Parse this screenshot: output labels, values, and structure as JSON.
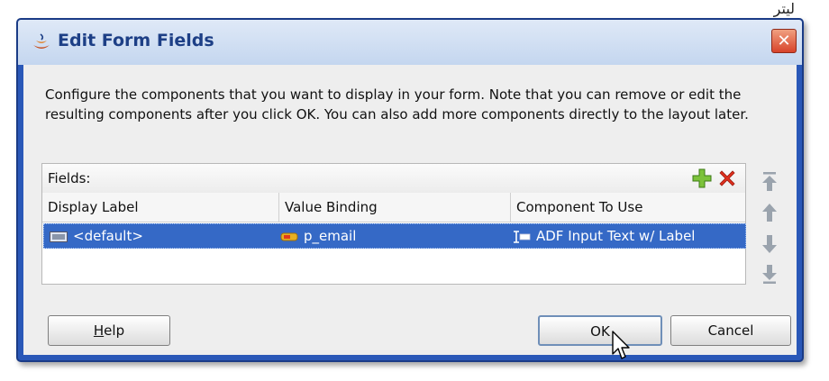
{
  "background_text": "ليتر",
  "dialog": {
    "title": "Edit Form Fields",
    "close": "✕",
    "description": "Configure the components that you want to display in your form.  Note that you can remove or edit the resulting components after you click OK.  You can also add more components directly to the layout later."
  },
  "fields": {
    "label": "Fields:",
    "columns": [
      "Display Label",
      "Value Binding",
      "Component To Use"
    ],
    "rows": [
      {
        "display_label": "<default>",
        "value_binding": "p_email",
        "component": "ADF Input Text w/ Label"
      }
    ]
  },
  "buttons": {
    "help_u": "H",
    "help_rest": "elp",
    "ok": "OK",
    "cancel": "Cancel"
  },
  "colors": {
    "frame": "#2a58b8",
    "selection": "#3569c6",
    "body": "#eeeeee"
  }
}
